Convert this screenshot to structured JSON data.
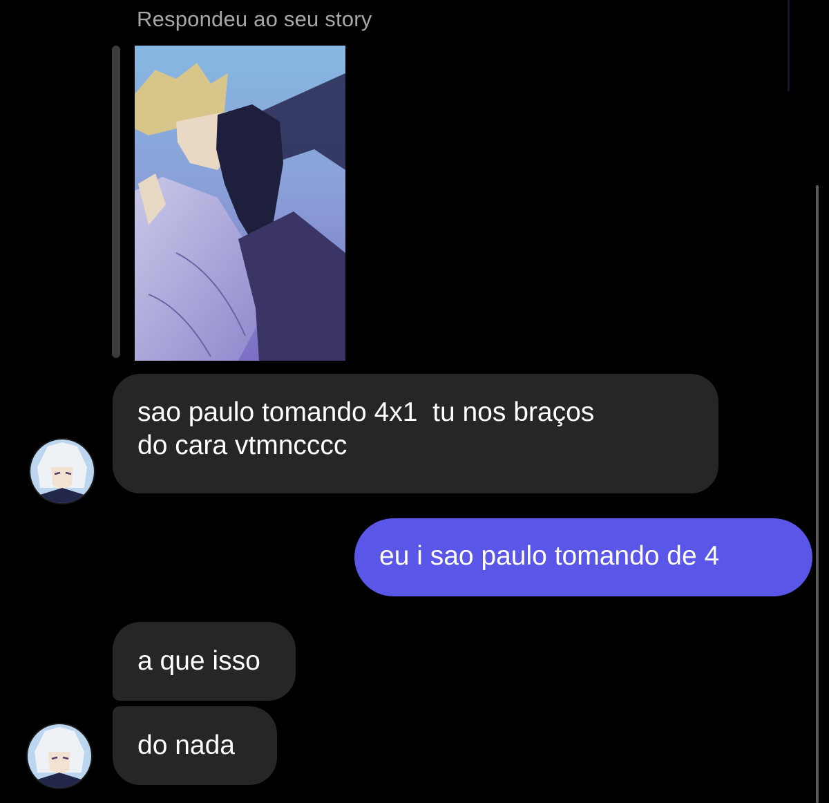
{
  "header": {
    "reply_label": "Respondeu ao seu story"
  },
  "story": {
    "thumbnail_icon": "story-image",
    "description": ""
  },
  "messages": [
    {
      "side": "incoming",
      "lines": [
        "sao paulo tomando 4x1  tu nos braços",
        "do cara vtmncccc"
      ]
    },
    {
      "side": "outgoing",
      "text": "eu i sao paulo tomando de 4"
    },
    {
      "side": "incoming",
      "text": "a que isso"
    },
    {
      "side": "incoming",
      "text": "do nada"
    }
  ],
  "colors": {
    "background": "#000000",
    "incoming_bubble": "#262626",
    "outgoing_bubble": "#5a56e8",
    "header_text": "#a8a8a8"
  }
}
